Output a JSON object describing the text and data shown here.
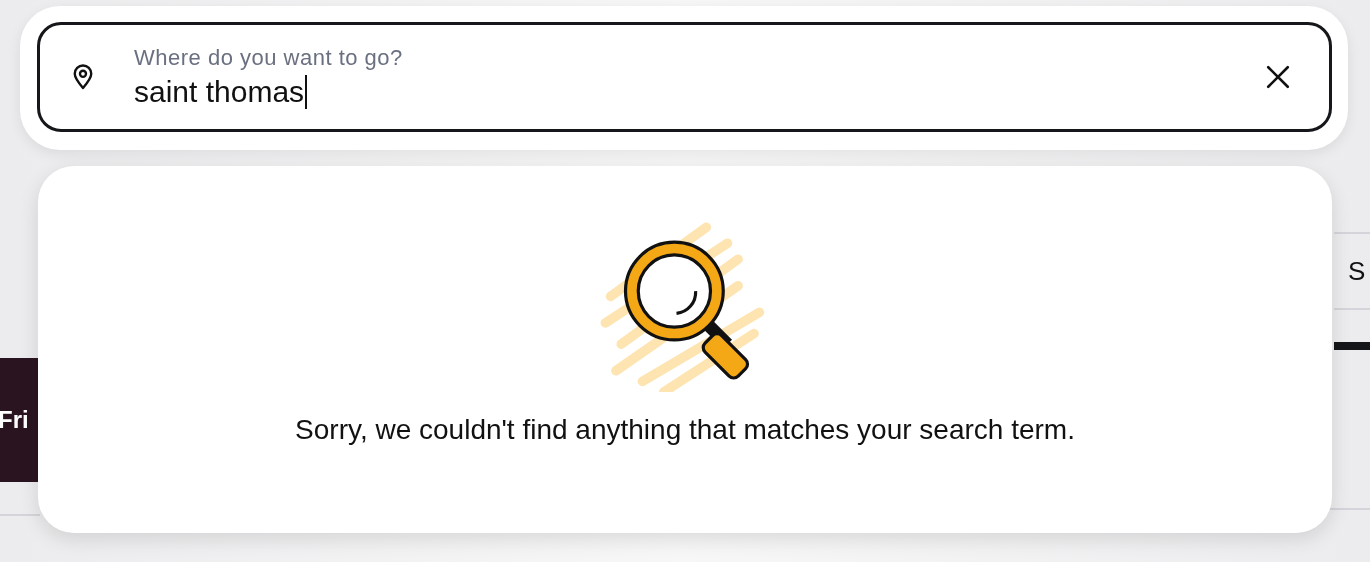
{
  "search": {
    "label": "Where do you want to go?",
    "value": "saint thomas"
  },
  "results": {
    "message": "Sorry, we couldn't find anything that matches your search term."
  },
  "background": {
    "banner_text": "Fri",
    "tab_text": "S"
  }
}
